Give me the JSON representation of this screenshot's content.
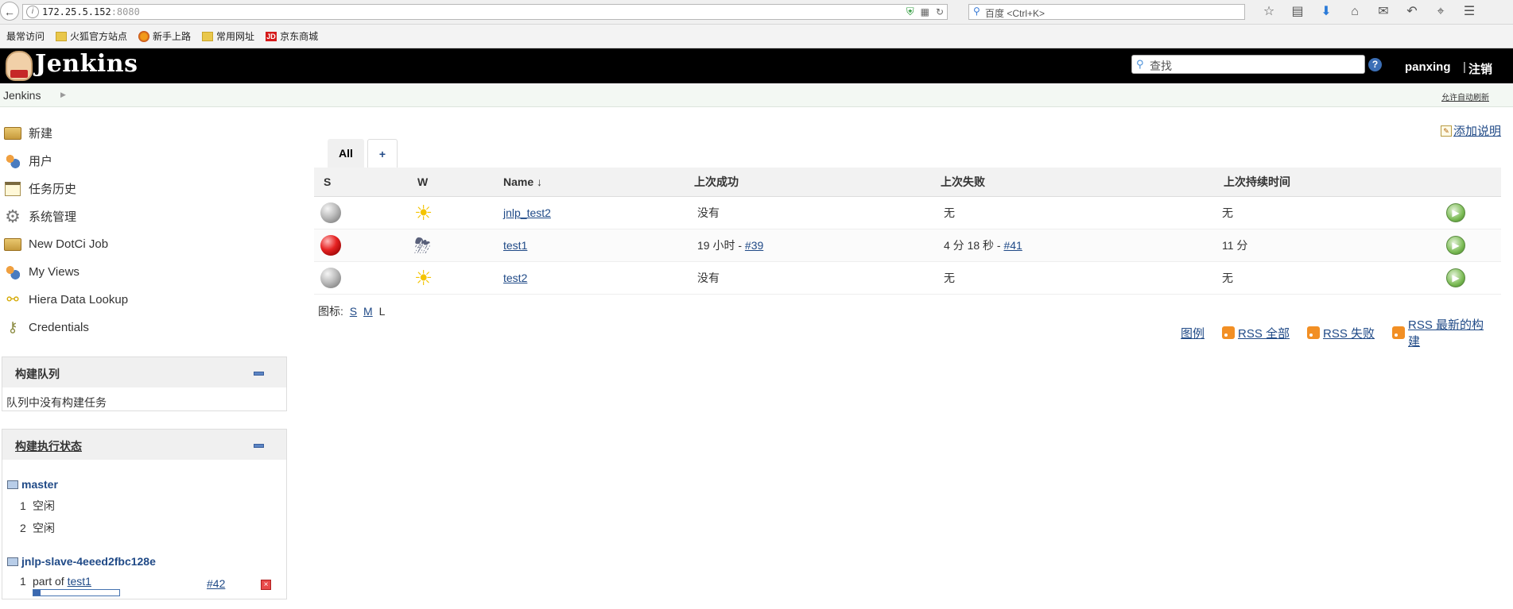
{
  "browser": {
    "url_host": "172.25.5.152",
    "url_port": ":8080",
    "search_placeholder": "百度 <Ctrl+K>",
    "bookmarks": [
      {
        "label": "最常访问",
        "icon": "none"
      },
      {
        "label": "火狐官方站点",
        "icon": "folder"
      },
      {
        "label": "新手上路",
        "icon": "firefox"
      },
      {
        "label": "常用网址",
        "icon": "folder"
      },
      {
        "label": "京东商城",
        "icon": "jd",
        "badge": "JD"
      }
    ]
  },
  "header": {
    "logo_text": "Jenkins",
    "search_placeholder": "查找",
    "help": "?",
    "user": "panxing",
    "logout": "注销"
  },
  "breadcrumb": {
    "root": "Jenkins",
    "auto_refresh": "允许自动刷新"
  },
  "sidebar": {
    "tasks": [
      {
        "label": "新建",
        "icon": "new-item-icon"
      },
      {
        "label": "用户",
        "icon": "users-icon"
      },
      {
        "label": "任务历史",
        "icon": "build-history-icon"
      },
      {
        "label": "系统管理",
        "icon": "gear-icon"
      },
      {
        "label": "New DotCi Job",
        "icon": "new-item-icon"
      },
      {
        "label": "My Views",
        "icon": "users-icon"
      },
      {
        "label": "Hiera Data Lookup",
        "icon": "nodes-icon"
      },
      {
        "label": "Credentials",
        "icon": "keys-icon"
      }
    ],
    "queue": {
      "title": "构建队列",
      "empty": "队列中没有构建任务"
    },
    "executors": {
      "title": "构建执行状态",
      "computers": [
        {
          "name": "master",
          "executors": [
            {
              "num": "1",
              "status": "空闲"
            },
            {
              "num": "2",
              "status": "空闲"
            }
          ]
        },
        {
          "name": "jnlp-slave-4eeed2fbc128e",
          "executors": [
            {
              "num": "1",
              "status": "part of",
              "job": "test1",
              "build": "#42",
              "progress": 0.08
            }
          ]
        }
      ]
    }
  },
  "main": {
    "add_description": "添加说明",
    "tabs": [
      {
        "label": "All",
        "active": true
      },
      {
        "label": "+",
        "active": false
      }
    ],
    "columns": {
      "s": "S",
      "w": "W",
      "name": "Name",
      "sort": "↓",
      "last_success": "上次成功",
      "last_failure": "上次失败",
      "last_duration": "上次持续时间"
    },
    "jobs": [
      {
        "status": "grey",
        "weather": "sunny",
        "name": "jnlp_test2",
        "last_success": "没有",
        "last_success_build": "",
        "last_failure": "无",
        "last_failure_build": "",
        "duration": "无"
      },
      {
        "status": "red",
        "weather": "thunderstorm",
        "name": "test1",
        "last_success": "19 小时 - ",
        "last_success_build": "#39",
        "last_failure": "4 分 18 秒 - ",
        "last_failure_build": "#41",
        "duration": "11 分"
      },
      {
        "status": "grey",
        "weather": "sunny",
        "name": "test2",
        "last_success": "没有",
        "last_success_build": "",
        "last_failure": "无",
        "last_failure_build": "",
        "duration": "无"
      }
    ],
    "icon_size": {
      "label": "图标:",
      "s": "S",
      "m": "M",
      "l": "L"
    },
    "footer_links": {
      "legend": "图例",
      "rss_all": "RSS 全部",
      "rss_failed": "RSS 失败",
      "rss_latest": "RSS 最新的构建"
    }
  }
}
